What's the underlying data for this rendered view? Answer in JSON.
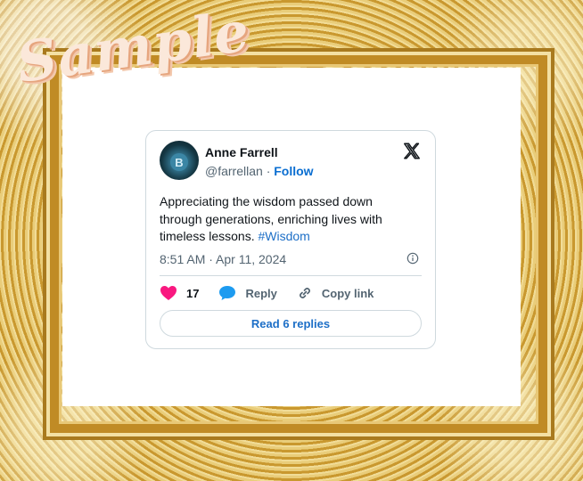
{
  "watermark": "Sample",
  "tweet": {
    "author_name": "Anne Farrell",
    "handle": "@farrellan",
    "separator": "·",
    "follow_label": "Follow",
    "text": "Appreciating the wisdom passed down through generations, enriching lives with timeless lessons.",
    "hashtag": "#Wisdom",
    "timestamp": "8:51 AM · Apr 11, 2024",
    "like_count": "17",
    "reply_label": "Reply",
    "copy_link_label": "Copy link",
    "read_replies_label": "Read 6 replies"
  },
  "colors": {
    "like": "#f91880",
    "reply": "#1d9bf0",
    "link": "#1d6fc7",
    "frame_gold": "#c8962c"
  },
  "icons": {
    "brand": "x-logo-icon",
    "info": "info-icon",
    "like": "heart-icon",
    "reply": "speech-bubble-icon",
    "copy": "link-icon"
  }
}
